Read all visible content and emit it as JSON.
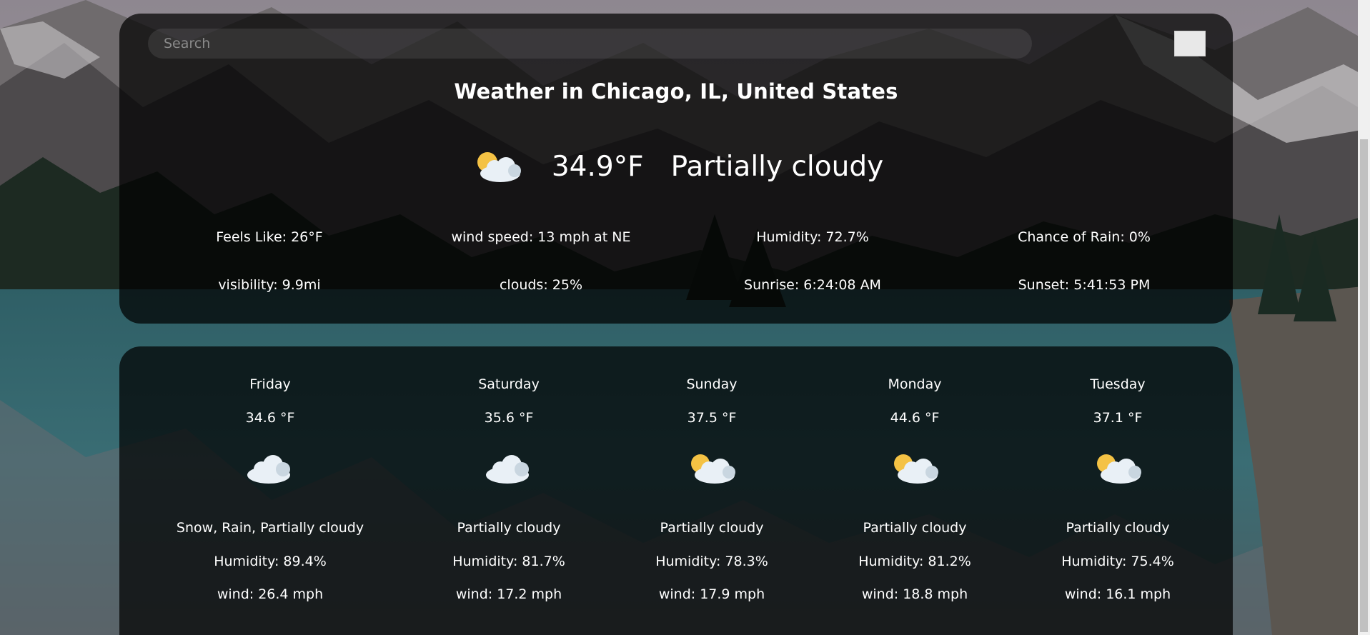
{
  "search": {
    "placeholder": "Search",
    "value": ""
  },
  "current": {
    "title": "Weather in Chicago, IL, United States",
    "icon": "partly-cloudy-day-icon",
    "temp": "34.9°F",
    "desc": "Partially cloudy",
    "details": {
      "feels_like": "Feels Like: 26°F",
      "wind": "wind speed: 13 mph at NE",
      "humidity": "Humidity: 72.7%",
      "rain": "Chance of Rain: 0%",
      "visibility": "visibility: 9.9mi",
      "clouds": "clouds: 25%",
      "sunrise": "Sunrise: 6:24:08 AM",
      "sunset": "Sunset: 5:41:53 PM"
    }
  },
  "forecast": [
    {
      "day": "Friday",
      "temp": "34.6 °F",
      "icon": "cloudy-icon",
      "desc": "Snow, Rain, Partially cloudy",
      "humidity": "Humidity: 89.4%",
      "wind": "wind: 26.4 mph"
    },
    {
      "day": "Saturday",
      "temp": "35.6 °F",
      "icon": "cloudy-icon",
      "desc": "Partially cloudy",
      "humidity": "Humidity: 81.7%",
      "wind": "wind: 17.2 mph"
    },
    {
      "day": "Sunday",
      "temp": "37.5 °F",
      "icon": "partly-cloudy-day-icon",
      "desc": "Partially cloudy",
      "humidity": "Humidity: 78.3%",
      "wind": "wind: 17.9 mph"
    },
    {
      "day": "Monday",
      "temp": "44.6 °F",
      "icon": "partly-cloudy-day-icon",
      "desc": "Partially cloudy",
      "humidity": "Humidity: 81.2%",
      "wind": "wind: 18.8 mph"
    },
    {
      "day": "Tuesday",
      "temp": "37.1 °F",
      "icon": "partly-cloudy-day-icon",
      "desc": "Partially cloudy",
      "humidity": "Humidity: 75.4%",
      "wind": "wind: 16.1 mph"
    }
  ],
  "colors": {
    "card_bg": "#000000",
    "text": "#ffffff",
    "sun": "#f4c244",
    "cloud": "#e9f0f6"
  }
}
